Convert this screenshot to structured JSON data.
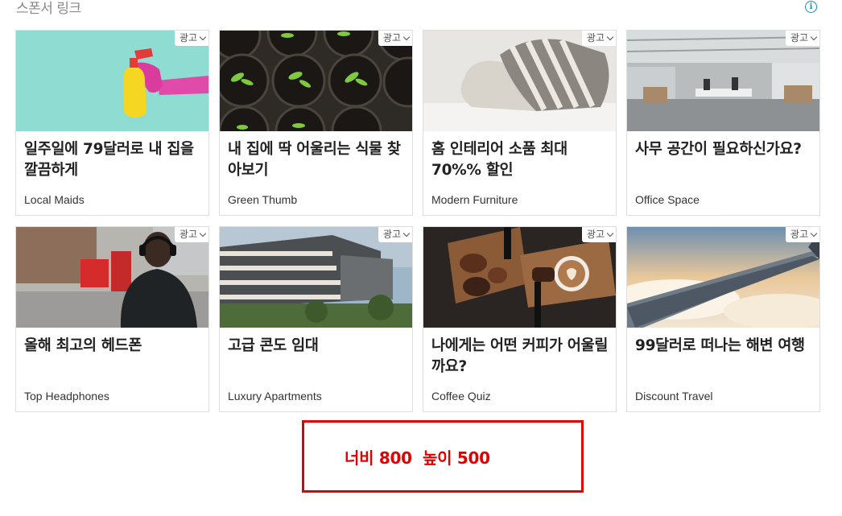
{
  "header": {
    "title": "스폰서 링크",
    "info_icon": "info-icon"
  },
  "ad_badge_label": "광고",
  "cards": [
    {
      "title": "일주일에 79달러로 내 집을 깔끔하게",
      "source": "Local Maids",
      "image": "spray-bottle-glove"
    },
    {
      "title": "내 집에 딱 어울리는 식물 찾아보기",
      "source": "Green Thumb",
      "image": "potted-seedlings"
    },
    {
      "title": "홈 인테리어 소품 최대 70%% 할인",
      "source": "Modern Furniture",
      "image": "bed-pillows"
    },
    {
      "title": "사무 공간이 필요하신가요?",
      "source": "Office Space",
      "image": "open-office"
    },
    {
      "title": "올해 최고의 헤드폰",
      "source": "Top Headphones",
      "image": "man-with-headphones-street"
    },
    {
      "title": "고급 콘도 임대",
      "source": "Luxury Apartments",
      "image": "condo-building"
    },
    {
      "title": "나에게는 어떤 커피가 어울릴까요?",
      "source": "Coffee Quiz",
      "image": "coffee-beans-latte"
    },
    {
      "title": "99달러로 떠나는 해변 여행",
      "source": "Discount Travel",
      "image": "airplane-wing-sky"
    }
  ],
  "size_annotation": {
    "text": "너비 800  높이 500",
    "color": "#e00000"
  }
}
